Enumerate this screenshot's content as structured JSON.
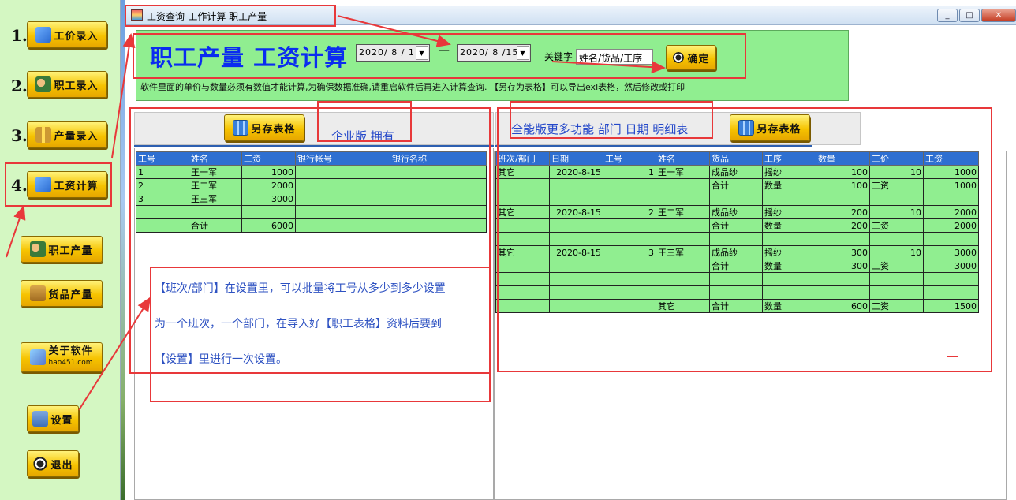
{
  "sidebar": {
    "items": [
      {
        "num": "1.",
        "label": "工价录入"
      },
      {
        "num": "2.",
        "label": "职工录入"
      },
      {
        "num": "3.",
        "label": "产量录入"
      },
      {
        "num": "4.",
        "label": "工资计算"
      }
    ],
    "worker_output": "职工产量",
    "goods_output": "货品产量",
    "about_label": "关于软件",
    "about_sub": "hao451.com",
    "settings": "设置",
    "exit": "退出"
  },
  "window": {
    "title": "工资查询-工作计算 职工产量",
    "min": "_",
    "max": "□",
    "close": "✕"
  },
  "header": {
    "title": "职工产量 工资计算",
    "date_from": "2020/ 8 / 1",
    "dash": "—",
    "date_to": "2020/ 8 /15",
    "keyword_label": "关键字",
    "keyword_value": "姓名/货品/工序",
    "confirm": "确定",
    "notes": "软件里面的单价与数量必须有数值才能计算,为确保数据准确,请重启软件后再进入计算查询.     【另存为表格】可以导出exl表格，然后修改或打印"
  },
  "left_panel": {
    "save_button": "另存表格",
    "edition": "企业版 拥有",
    "columns": [
      "工号",
      "姓名",
      "工资",
      "银行帐号",
      "银行名称"
    ],
    "rows": [
      [
        "1",
        "王一军",
        "1000",
        "",
        ""
      ],
      [
        "2",
        "王二军",
        "2000",
        "",
        ""
      ],
      [
        "3",
        "王三军",
        "3000",
        "",
        ""
      ],
      [
        "",
        "",
        "",
        "",
        ""
      ],
      [
        "",
        "合计",
        "6000",
        "",
        ""
      ]
    ]
  },
  "right_panel": {
    "feature_text": "全能版更多功能  部门 日期 明细表",
    "save_button": "另存表格",
    "columns": [
      "班次/部门",
      "日期",
      "工号",
      "姓名",
      "货品",
      "工序",
      "数量",
      "工价",
      "工资"
    ],
    "rows": [
      [
        "其它",
        "2020-8-15",
        "1",
        "王一军",
        "成品纱",
        "摇纱",
        "100",
        "10",
        "1000"
      ],
      [
        "",
        "",
        "",
        "",
        "合计",
        "数量",
        "100",
        "工资",
        "1000"
      ],
      [
        "",
        "",
        "",
        "",
        "",
        "",
        "",
        "",
        ""
      ],
      [
        "其它",
        "2020-8-15",
        "2",
        "王二军",
        "成品纱",
        "摇纱",
        "200",
        "10",
        "2000"
      ],
      [
        "",
        "",
        "",
        "",
        "合计",
        "数量",
        "200",
        "工资",
        "2000"
      ],
      [
        "",
        "",
        "",
        "",
        "",
        "",
        "",
        "",
        ""
      ],
      [
        "其它",
        "2020-8-15",
        "3",
        "王三军",
        "成品纱",
        "摇纱",
        "300",
        "10",
        "3000"
      ],
      [
        "",
        "",
        "",
        "",
        "合计",
        "数量",
        "300",
        "工资",
        "3000"
      ],
      [
        "",
        "",
        "",
        "",
        "",
        "",
        "",
        "",
        ""
      ],
      [
        "",
        "",
        "",
        "",
        "",
        "",
        "",
        "",
        ""
      ],
      [
        "",
        "",
        "",
        "其它",
        "合计",
        "数量",
        "600",
        "工资",
        "1500"
      ]
    ]
  },
  "annotation": {
    "line1": "【班次/部门】在设置里，可以批量将工号从多少到多少设置",
    "line2": "为一个班次，一个部门，在导入好【职工表格】资料后要到",
    "line3": "【设置】里进行一次设置。"
  },
  "colors": {
    "accent_red": "#e8383a",
    "green": "#90ee90",
    "header_blue": "#2e6fd1",
    "title_blue": "#0a2cf0"
  }
}
